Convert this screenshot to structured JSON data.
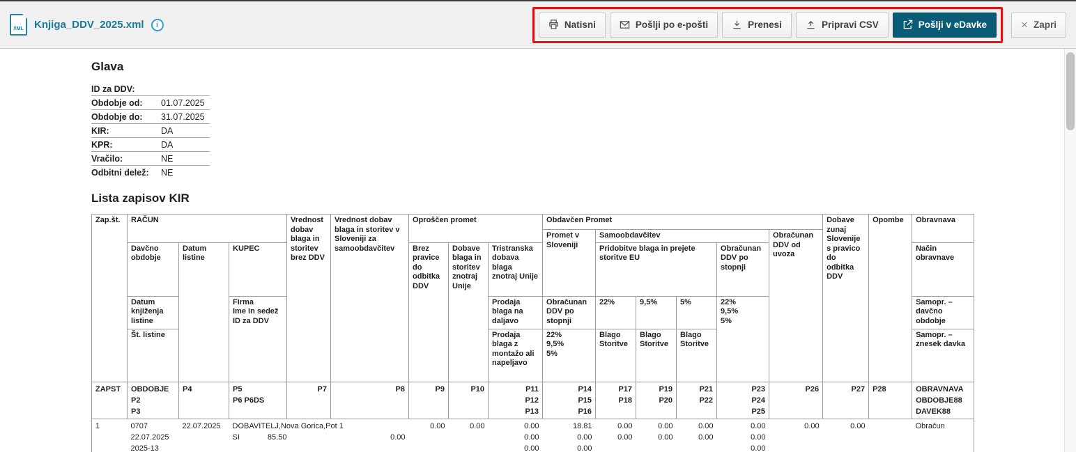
{
  "colors": {
    "title_teal": "#1a7b99",
    "primary_button": "#0a5b76",
    "highlight_red": "#e01212",
    "info_blue": "#2e9fd4"
  },
  "window": {
    "file_title": "Knjiga_DDV_2025.xml",
    "xml_badge": "XML",
    "info_glyph": "i"
  },
  "toolbar": {
    "natisni": "Natisni",
    "poslji_po_eposti": "Pošlji po e-pošti",
    "prenesi": "Prenesi",
    "pripravi_csv": "Pripravi CSV",
    "poslji_v_edavke": "Pošlji v eDavke",
    "zapri": "Zapri",
    "zapri_glyph": "×"
  },
  "glava": {
    "heading": "Glava",
    "rows": [
      {
        "label": "ID za DDV:",
        "value": ""
      },
      {
        "label": "Obdobje od:",
        "value": "01.07.2025"
      },
      {
        "label": "Obdobje do:",
        "value": "31.07.2025"
      },
      {
        "label": "KIR:",
        "value": "DA"
      },
      {
        "label": "KPR:",
        "value": "DA"
      },
      {
        "label": "Vračilo:",
        "value": "NE"
      },
      {
        "label": "Odbitni delež:",
        "value": "NE"
      }
    ]
  },
  "kir": {
    "heading": "Lista zapisov KIR",
    "h": {
      "zapst": "Zap.št.",
      "racun": "RAČUN",
      "davcno_obdobje": "Davčno obdobje",
      "datum_listine": "Datum listine",
      "kupec": "KUPEC",
      "datum_knjizenja": "Datum knjiženja listine",
      "st_listine": "Št. listine",
      "firma": "Firma\nIme in sedež\nID za DDV",
      "p7": "Vrednost dobav blaga in storitev brez DDV",
      "p8": "Vrednost dobav blaga in storitev v Sloveniji za samoobdavčitev",
      "oproscen": "Oproščen promet",
      "p9": "Brez pravice do odbitka DDV",
      "p10": "Dobave blaga in storitev znotraj Unije",
      "tristranska": "Tristranska dobava blaga znotraj Unije",
      "prodaja_daljavo": "Prodaja blaga na daljavo",
      "prodaja_montaza": "Prodaja blaga z montažo ali napeljavo",
      "obdavcen": "Obdavčen Promet",
      "promet_slo": "Promet v Sloveniji",
      "samoobdavcitev": "Samoobdavčitev",
      "obracunan_stopnja": "Obračunan DDV po stopnji",
      "stopnje": "22%\n9,5%\n5%",
      "pridobitve": "Pridobitve blaga in prejete storitve EU",
      "r22": "22%",
      "r95": "9,5%",
      "r5": "5%",
      "blago_storitve": "Blago\nStoritve",
      "obracunan_uvoz": "Obračunan DDV od uvoza",
      "p27": "Dobave zunaj Slovenije s pravico do odbitka DDV",
      "opombe": "Opombe",
      "obravnava": "Obravnava",
      "nacin": "Način obravnave",
      "samopr_obdobje": "Samopr. – davčno obdobje",
      "samopr_znesek": "Samopr. – znesek davka"
    },
    "codes": {
      "c1": "ZAPST",
      "c2": "OBDOBJE\nP2\nP3",
      "c3": "P4",
      "c4": "P5\nP6 P6DS",
      "c5": "P7",
      "c6": "P8",
      "c7": "P9",
      "c8": "P10",
      "c9": "P11\nP12\nP13",
      "c10": "P14\nP15\nP16",
      "c11": "P17\nP18",
      "c12": "P19\nP20",
      "c13": "P21\nP22",
      "c14": "P23\nP24\nP25",
      "c15": "P26",
      "c16": "P27",
      "c17": "P28",
      "c18": "OBRAVNAVA\nOBDOBJE88\nDAVEK88"
    },
    "row1": {
      "c1": "1",
      "c2": "0707\n22.07.2025\n2025-13",
      "c3": "22.07.2025",
      "c4_firma": "DOBAVITELJ,Nova Gorica,Pot 1",
      "c4_id": "SI",
      "c4_znesek": "85.50",
      "c5": "",
      "c6": " \n0.00",
      "c7": "0.00",
      "c8": "0.00",
      "c9": "0.00\n0.00\n0.00",
      "c10": "18.81\n0.00\n0.00",
      "c11": "0.00\n0.00",
      "c12": "0.00\n0.00",
      "c13": "0.00\n0.00",
      "c14": "0.00\n0.00\n0.00",
      "c15": "0.00",
      "c16": "0.00",
      "c17": "",
      "c18": "Obračun"
    }
  }
}
